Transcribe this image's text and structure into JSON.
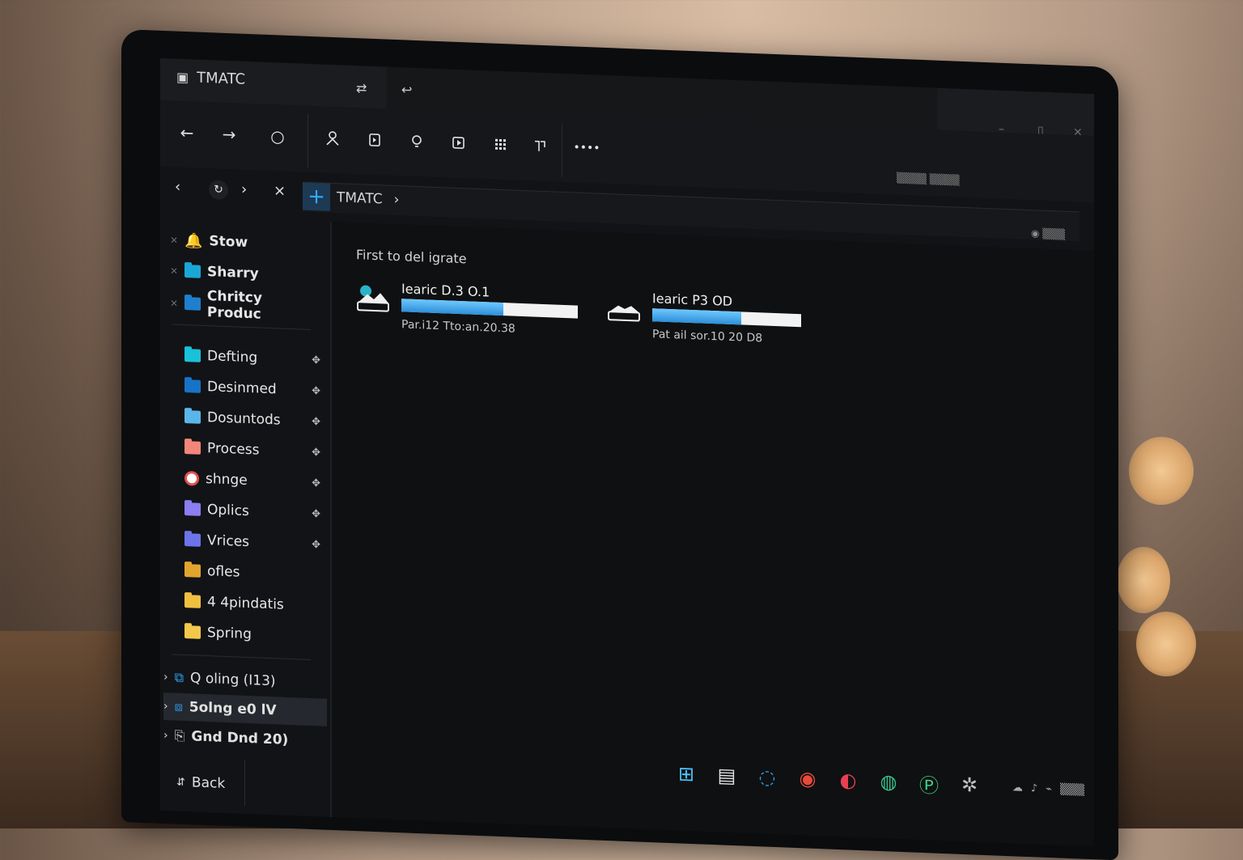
{
  "window": {
    "app_title": "TMATC",
    "tab_icons": [
      "swap-icon",
      "back-arrow-icon"
    ]
  },
  "toolbar": {
    "nav": [
      "←",
      "→",
      "○"
    ],
    "tools": [
      "person-icon",
      "document-icon",
      "bulb-icon",
      "play-icon",
      "grid-icon",
      "split-icon"
    ],
    "more_label": "••••"
  },
  "address": {
    "path": [
      "TMATC",
      "›"
    ]
  },
  "sidebar": {
    "pinned": [
      {
        "label": "Stow",
        "color": "#e7b04a",
        "icon": "bell-icon"
      },
      {
        "label": "Sharry",
        "color": "#1aa7d6"
      },
      {
        "label": "Chritcy Produc",
        "color": "#1e7fcf"
      }
    ],
    "folders": [
      {
        "label": "Defting",
        "color": "#19c2d9"
      },
      {
        "label": "Desinmed",
        "color": "#1673c8"
      },
      {
        "label": "Dosuntods",
        "color": "#5ab6e8"
      },
      {
        "label": "Process",
        "color": "#f2867a"
      },
      {
        "label": "shnge",
        "color": "#e25151"
      },
      {
        "label": "Oplics",
        "color": "#8b7df2"
      },
      {
        "label": "Vrices",
        "color": "#6d73e8"
      },
      {
        "label": "ofles",
        "color": "#e1a52f"
      },
      {
        "label": "4 4pindatis",
        "color": "#efc040"
      },
      {
        "label": "Spring",
        "color": "#f3c94b"
      }
    ],
    "drives": [
      {
        "label": "Q oling (I13)"
      },
      {
        "label": "5olng e0 lV"
      },
      {
        "label": "Gnd Dnd 20)"
      }
    ],
    "back_label": "Back"
  },
  "main": {
    "section_title": "First to del igrate",
    "drives": [
      {
        "name": "Iearic D.3 O.1",
        "info": "Par.i12 Tto:an.20.38",
        "fill": 0.58
      },
      {
        "name": "Iearic P3 OD",
        "info": "Pat ail sor.10 20 D8",
        "fill": 0.6
      }
    ]
  },
  "taskbar": {
    "apps": [
      {
        "icon": "windows-icon",
        "color": "#4cc3ff"
      },
      {
        "icon": "files-icon",
        "color": "#e5e5e5"
      },
      {
        "icon": "edge-icon",
        "color": "#2aa1f0"
      },
      {
        "icon": "chrome-icon",
        "color": "#e84a3a"
      },
      {
        "icon": "app-red-icon",
        "color": "#ea3f52"
      },
      {
        "icon": "app-green-icon",
        "color": "#38c48b"
      },
      {
        "icon": "app-p-icon",
        "color": "#3ed28a"
      },
      {
        "icon": "gear-icon",
        "color": "#bdbdbd"
      }
    ]
  }
}
